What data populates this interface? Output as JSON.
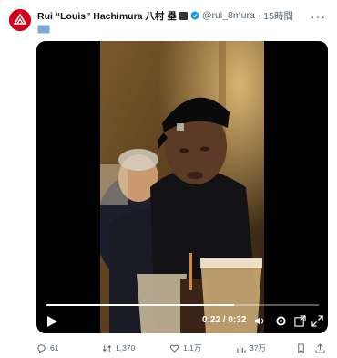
{
  "post": {
    "display_name": "Rui “Louis” Hachimura 八村 塁",
    "handle": "@rui_8mura",
    "separator": "·",
    "time": "15時間",
    "more_label": "···"
  },
  "video": {
    "current_time": "0:22",
    "time_separator": " / ",
    "duration": "0:32",
    "progress": 0.69
  },
  "actions": {
    "replies": "61",
    "reposts": "1,370",
    "likes": "1.1万",
    "views": "37万"
  },
  "colors": {
    "accent": "#1d9bf0",
    "muted": "#536471",
    "avatar": "#d0021b"
  },
  "icons": {
    "avatar": "red-circle-logo",
    "verified": "verified-badge-icon",
    "reply": "reply-icon",
    "repost": "repost-icon",
    "like": "heart-icon",
    "views": "bar-chart-icon",
    "bookmark": "bookmark-icon",
    "share": "share-icon"
  }
}
